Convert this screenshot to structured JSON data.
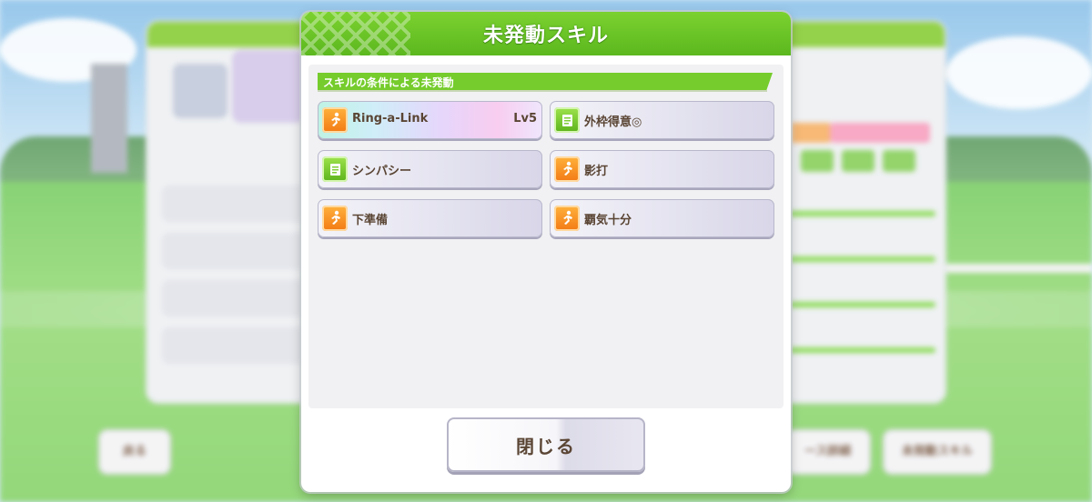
{
  "modal": {
    "title": "未発動スキル",
    "section_label": "スキルの条件による未発動",
    "skills": [
      {
        "name": "Ring-a-Link",
        "level": "Lv5",
        "icon": "running-icon"
      },
      {
        "name": "外枠得意◎",
        "level": "",
        "icon": "card-icon"
      },
      {
        "name": "シンパシー",
        "level": "",
        "icon": "card-icon"
      },
      {
        "name": "影打",
        "level": "",
        "icon": "running-icon"
      },
      {
        "name": "下準備",
        "level": "",
        "icon": "running-icon"
      },
      {
        "name": "覇気十分",
        "level": "",
        "icon": "running-icon"
      }
    ],
    "close_label": "閉じる"
  },
  "background": {
    "left_button": "戻る",
    "right_buttons": [
      "ース詳細",
      "未発動スキル"
    ]
  },
  "colors": {
    "header_green": "#6ccb25",
    "text_brown": "#5a4534",
    "icon_orange": "#f58a1f",
    "icon_green": "#7fce35"
  }
}
